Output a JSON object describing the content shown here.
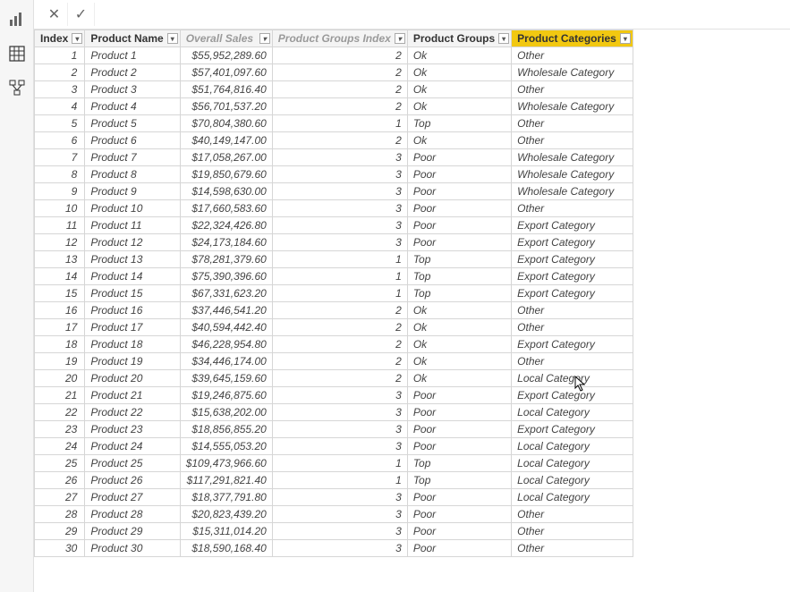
{
  "rail": {
    "report_icon": "bar-chart-icon",
    "data_icon": "table-icon",
    "model_icon": "model-icon"
  },
  "formula_bar": {
    "cancel": "✕",
    "confirm": "✓"
  },
  "columns": {
    "index": "Index",
    "product_name": "Product Name",
    "overall_sales": "Overall Sales",
    "product_groups_index": "Product Groups Index",
    "product_groups": "Product Groups",
    "product_categories": "Product Categories"
  },
  "selected_column": "product_categories",
  "rows": [
    {
      "index": "1",
      "name": "Product 1",
      "sales": "$55,952,289.60",
      "pgi": "2",
      "pg": "Ok",
      "pc": "Other"
    },
    {
      "index": "2",
      "name": "Product 2",
      "sales": "$57,401,097.60",
      "pgi": "2",
      "pg": "Ok",
      "pc": "Wholesale Category"
    },
    {
      "index": "3",
      "name": "Product 3",
      "sales": "$51,764,816.40",
      "pgi": "2",
      "pg": "Ok",
      "pc": "Other"
    },
    {
      "index": "4",
      "name": "Product 4",
      "sales": "$56,701,537.20",
      "pgi": "2",
      "pg": "Ok",
      "pc": "Wholesale Category"
    },
    {
      "index": "5",
      "name": "Product 5",
      "sales": "$70,804,380.60",
      "pgi": "1",
      "pg": "Top",
      "pc": "Other"
    },
    {
      "index": "6",
      "name": "Product 6",
      "sales": "$40,149,147.00",
      "pgi": "2",
      "pg": "Ok",
      "pc": "Other"
    },
    {
      "index": "7",
      "name": "Product 7",
      "sales": "$17,058,267.00",
      "pgi": "3",
      "pg": "Poor",
      "pc": "Wholesale Category"
    },
    {
      "index": "8",
      "name": "Product 8",
      "sales": "$19,850,679.60",
      "pgi": "3",
      "pg": "Poor",
      "pc": "Wholesale Category"
    },
    {
      "index": "9",
      "name": "Product 9",
      "sales": "$14,598,630.00",
      "pgi": "3",
      "pg": "Poor",
      "pc": "Wholesale Category"
    },
    {
      "index": "10",
      "name": "Product 10",
      "sales": "$17,660,583.60",
      "pgi": "3",
      "pg": "Poor",
      "pc": "Other"
    },
    {
      "index": "11",
      "name": "Product 11",
      "sales": "$22,324,426.80",
      "pgi": "3",
      "pg": "Poor",
      "pc": "Export Category"
    },
    {
      "index": "12",
      "name": "Product 12",
      "sales": "$24,173,184.60",
      "pgi": "3",
      "pg": "Poor",
      "pc": "Export Category"
    },
    {
      "index": "13",
      "name": "Product 13",
      "sales": "$78,281,379.60",
      "pgi": "1",
      "pg": "Top",
      "pc": "Export Category"
    },
    {
      "index": "14",
      "name": "Product 14",
      "sales": "$75,390,396.60",
      "pgi": "1",
      "pg": "Top",
      "pc": "Export Category"
    },
    {
      "index": "15",
      "name": "Product 15",
      "sales": "$67,331,623.20",
      "pgi": "1",
      "pg": "Top",
      "pc": "Export Category"
    },
    {
      "index": "16",
      "name": "Product 16",
      "sales": "$37,446,541.20",
      "pgi": "2",
      "pg": "Ok",
      "pc": "Other"
    },
    {
      "index": "17",
      "name": "Product 17",
      "sales": "$40,594,442.40",
      "pgi": "2",
      "pg": "Ok",
      "pc": "Other"
    },
    {
      "index": "18",
      "name": "Product 18",
      "sales": "$46,228,954.80",
      "pgi": "2",
      "pg": "Ok",
      "pc": "Export Category"
    },
    {
      "index": "19",
      "name": "Product 19",
      "sales": "$34,446,174.00",
      "pgi": "2",
      "pg": "Ok",
      "pc": "Other"
    },
    {
      "index": "20",
      "name": "Product 20",
      "sales": "$39,645,159.60",
      "pgi": "2",
      "pg": "Ok",
      "pc": "Local Category"
    },
    {
      "index": "21",
      "name": "Product 21",
      "sales": "$19,246,875.60",
      "pgi": "3",
      "pg": "Poor",
      "pc": "Export Category"
    },
    {
      "index": "22",
      "name": "Product 22",
      "sales": "$15,638,202.00",
      "pgi": "3",
      "pg": "Poor",
      "pc": "Local Category"
    },
    {
      "index": "23",
      "name": "Product 23",
      "sales": "$18,856,855.20",
      "pgi": "3",
      "pg": "Poor",
      "pc": "Export Category"
    },
    {
      "index": "24",
      "name": "Product 24",
      "sales": "$14,555,053.20",
      "pgi": "3",
      "pg": "Poor",
      "pc": "Local Category"
    },
    {
      "index": "25",
      "name": "Product 25",
      "sales": "$109,473,966.60",
      "pgi": "1",
      "pg": "Top",
      "pc": "Local Category"
    },
    {
      "index": "26",
      "name": "Product 26",
      "sales": "$117,291,821.40",
      "pgi": "1",
      "pg": "Top",
      "pc": "Local Category"
    },
    {
      "index": "27",
      "name": "Product 27",
      "sales": "$18,377,791.80",
      "pgi": "3",
      "pg": "Poor",
      "pc": "Local Category"
    },
    {
      "index": "28",
      "name": "Product 28",
      "sales": "$20,823,439.20",
      "pgi": "3",
      "pg": "Poor",
      "pc": "Other"
    },
    {
      "index": "29",
      "name": "Product 29",
      "sales": "$15,311,014.20",
      "pgi": "3",
      "pg": "Poor",
      "pc": "Other"
    },
    {
      "index": "30",
      "name": "Product 30",
      "sales": "$18,590,168.40",
      "pgi": "3",
      "pg": "Poor",
      "pc": "Other"
    }
  ]
}
